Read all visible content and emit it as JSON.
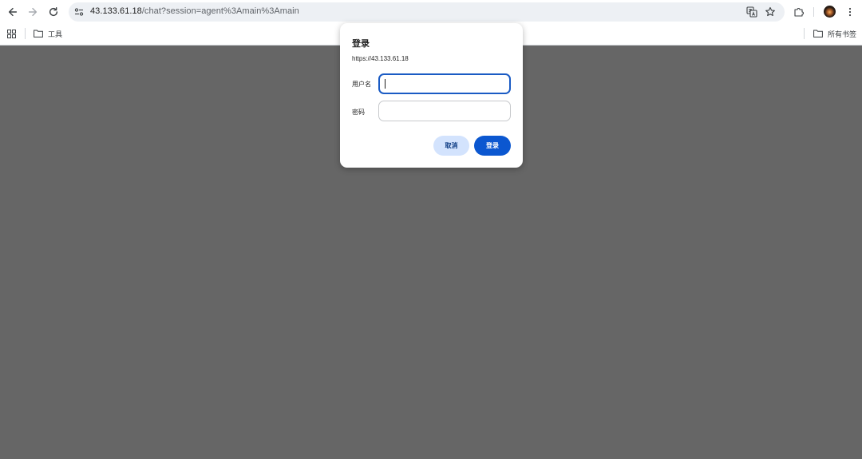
{
  "browser": {
    "url_host": "43.133.61.18",
    "url_path": "/chat?session=agent%3Amain%3Amain"
  },
  "bookmarks": {
    "folder_label": "工具",
    "all_bookmarks_label": "所有书签"
  },
  "dialog": {
    "title": "登录",
    "origin": "https://43.133.61.18",
    "username_label": "用户名",
    "username_value": "",
    "password_label": "密码",
    "password_value": "",
    "cancel_label": "取消",
    "submit_label": "登录"
  },
  "icons": {
    "back": "arrow-left-icon",
    "forward": "arrow-right-icon",
    "reload": "reload-icon",
    "site_info": "tune-icon",
    "translate": "translate-icon",
    "bookmark": "star-icon",
    "extensions": "puzzle-icon",
    "profile": "avatar",
    "menu": "more-vertical-icon",
    "apps": "apps-grid-icon",
    "folder": "folder-icon"
  },
  "colors": {
    "page_overlay": "#666666",
    "primary_button": "#0b57d0",
    "secondary_button": "#d3e3fd",
    "focus_ring": "#1a5bc4"
  }
}
